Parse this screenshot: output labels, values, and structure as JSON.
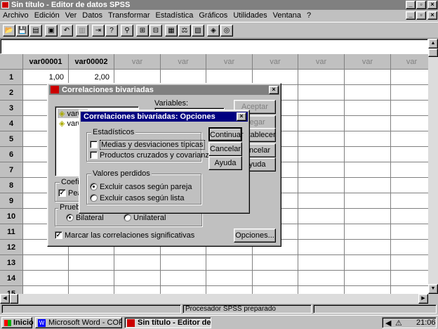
{
  "window": {
    "title": "Sin título - Editor de datos SPSS",
    "controls": [
      "_",
      "▫",
      "×"
    ]
  },
  "menu": [
    "Archivo",
    "Edición",
    "Ver",
    "Datos",
    "Transformar",
    "Estadística",
    "Gráficos",
    "Utilidades",
    "Ventana",
    "?"
  ],
  "grid": {
    "columns": [
      "var00001",
      "var00002",
      "var",
      "var",
      "var",
      "var",
      "var",
      "var",
      "var"
    ],
    "rows": [
      "1",
      "2",
      "3",
      "4",
      "5",
      "6",
      "7",
      "8",
      "9",
      "10",
      "11",
      "12",
      "13",
      "14",
      "15"
    ],
    "row1": [
      "1,00",
      "2,00"
    ]
  },
  "dialog_main": {
    "title": "Correlaciones bivariadas",
    "list_items": [
      "var00",
      "var00"
    ],
    "variables_label": "Variables:",
    "buttons": [
      "Aceptar",
      "Pegar",
      "Restablecer",
      "Cancelar",
      "Ayuda"
    ],
    "coef_label": "Coeficie",
    "pearson": "Pear",
    "prueba_label": "Prueba",
    "bilateral": "Bilateral",
    "unilateral": "Unilateral",
    "marcar": "Marcar las correlaciones significativas",
    "opciones": "Opciones..."
  },
  "dialog_options": {
    "title": "Correlaciones bivariadas: Opciones",
    "stats_group": "Estadísticos",
    "stat1": "Medias y desviaciones típicas",
    "stat2": "Productos cruzados y covarianzas",
    "missing_group": "Valores perdidos",
    "miss1": "Excluir casos según pareja",
    "miss2": "Excluir casos según lista",
    "continuar": "Continuar",
    "cancelar": "Cancelar",
    "ayuda": "Ayuda"
  },
  "status": "Procesador SPSS preparado",
  "taskbar": {
    "start": "Inicio",
    "tasks": [
      "Microsoft Word - CORREL...",
      "Sin título - Editor de ..."
    ],
    "clock": "21:06"
  }
}
